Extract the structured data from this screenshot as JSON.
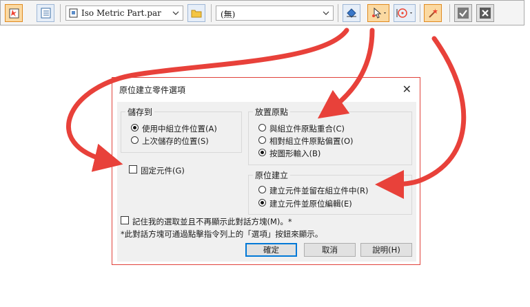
{
  "toolbar": {
    "part_template": "Iso Metric Part.par",
    "configuration": "(無)",
    "colors": {
      "accent": "#e08a1e",
      "button_border": "#9fb7d6"
    }
  },
  "dialog": {
    "title": "原位建立零件選項",
    "close_glyph": "✕",
    "save_to": {
      "legend": "儲存到",
      "options": [
        "使用中組立件位置(A)",
        "上次儲存的位置(S)"
      ],
      "selected": 0
    },
    "placement": {
      "legend": "放置原點",
      "options": [
        "與組立件原點重合(C)",
        "相對組立件原點偏置(O)",
        "按圖形輸入(B)"
      ],
      "selected": 2
    },
    "in_place": {
      "legend": "原位建立",
      "options": [
        "建立元件並留在組立件中(R)",
        "建立元件並原位編輯(E)"
      ],
      "selected": 1
    },
    "fixed_component_label": "固定元件(G)",
    "remember_label": "記住我的選取並且不再顯示此對話方塊(M)。*",
    "footnote": "*此對話方塊可通過點擊指令列上的「選項」按鈕來顯示。",
    "buttons": {
      "ok": "確定",
      "cancel": "取消",
      "help": "說明(H)"
    }
  },
  "annotation_color": "#e8413a"
}
